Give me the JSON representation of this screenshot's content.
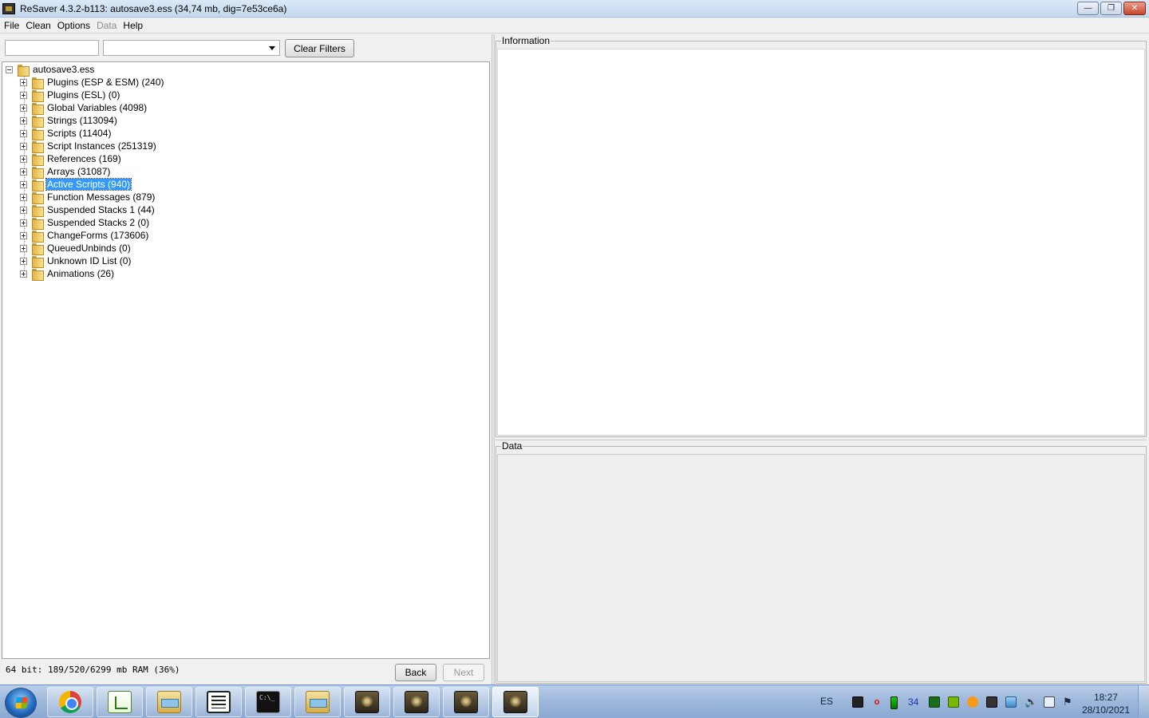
{
  "window": {
    "title": "ReSaver 4.3.2-b113: autosave3.ess (34,74 mb, dig=7e53ce6a)",
    "minimize_icon": "minimize-icon",
    "maximize_icon": "restore-icon",
    "close_icon": "close-icon"
  },
  "menu": {
    "items": [
      {
        "label": "File",
        "enabled": true
      },
      {
        "label": "Clean",
        "enabled": true
      },
      {
        "label": "Options",
        "enabled": true
      },
      {
        "label": "Data",
        "enabled": false
      },
      {
        "label": "Help",
        "enabled": true
      }
    ]
  },
  "filters": {
    "text_value": "",
    "combo_value": "",
    "clear_label": "Clear Filters"
  },
  "tree": {
    "root": "autosave3.ess",
    "items": [
      {
        "label": "Plugins (ESP & ESM) (240)"
      },
      {
        "label": "Plugins (ESL) (0)"
      },
      {
        "label": "Global Variables (4098)"
      },
      {
        "label": "Strings (113094)"
      },
      {
        "label": "Scripts (11404)"
      },
      {
        "label": "Script Instances (251319)"
      },
      {
        "label": "References (169)"
      },
      {
        "label": "Arrays (31087)"
      },
      {
        "label": "Active Scripts (940)",
        "selected": true
      },
      {
        "label": "Function Messages (879)"
      },
      {
        "label": "Suspended Stacks 1 (44)"
      },
      {
        "label": "Suspended Stacks 2 (0)"
      },
      {
        "label": "ChangeForms (173606)"
      },
      {
        "label": "QueuedUnbinds (0)"
      },
      {
        "label": "Unknown ID List (0)"
      },
      {
        "label": "Animations (26)"
      }
    ]
  },
  "status": {
    "memory": "64 bit: 189/520/6299 mb RAM (36%)",
    "back_label": "Back",
    "next_label": "Next"
  },
  "panels": {
    "information_title": "Information",
    "data_title": "Data"
  },
  "taskbar": {
    "apps": [
      "chrome-icon",
      "notepad-plus-plus-icon",
      "file-explorer-icon",
      "document-icon",
      "command-prompt-icon",
      "file-explorer-icon",
      "hard-drive-icon",
      "hard-drive-icon",
      "hard-drive-icon",
      "hard-drive-icon"
    ],
    "language": "ES",
    "tray_number": "34",
    "time": "18:27",
    "date": "28/10/2021"
  },
  "colors": {
    "selection": "#3399ff",
    "taskbar": "#9fb9dc"
  }
}
